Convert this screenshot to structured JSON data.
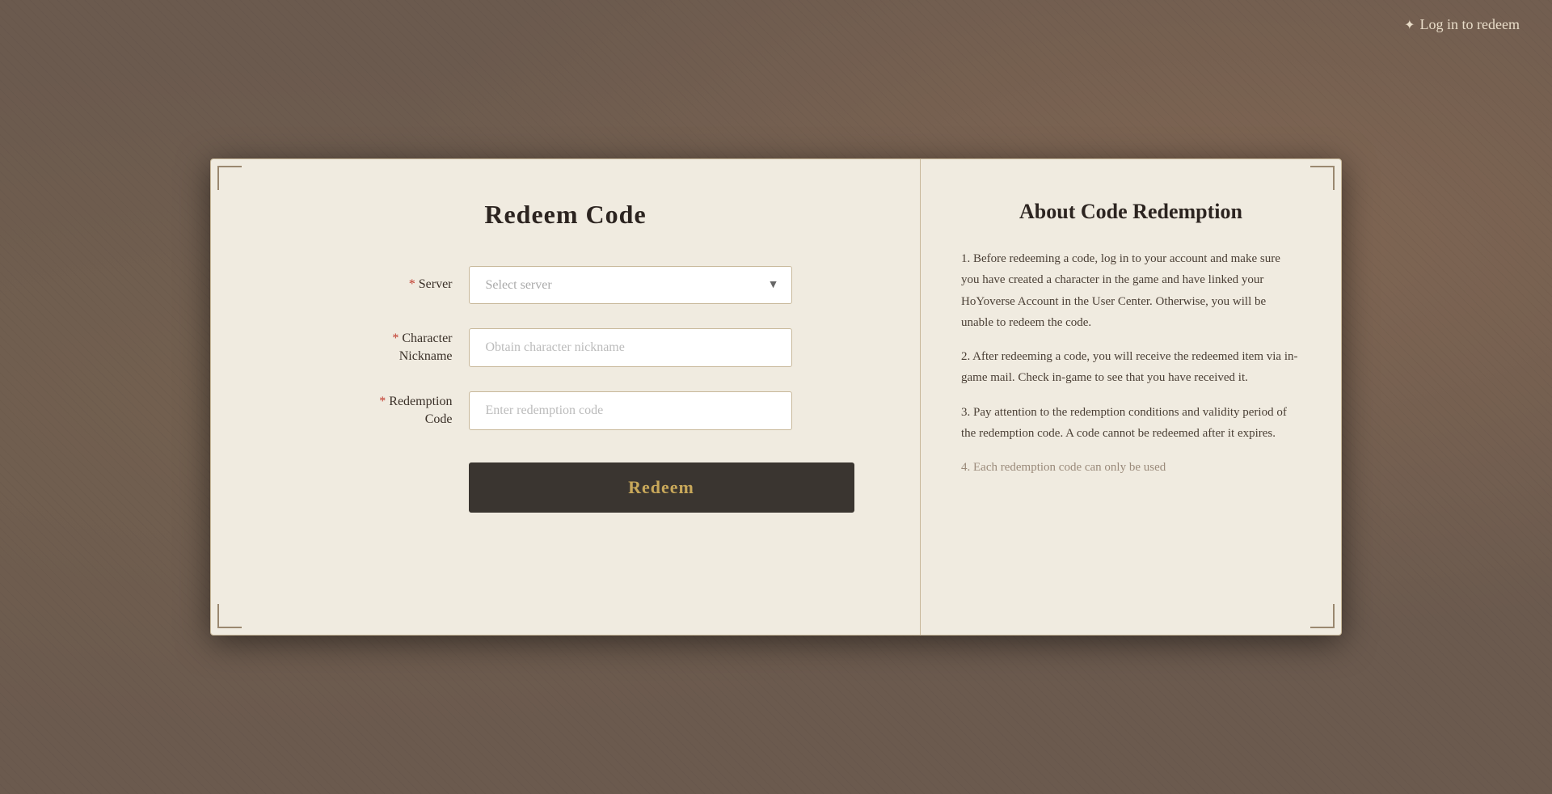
{
  "page": {
    "background_alt": "Game themed background"
  },
  "topbar": {
    "login_label": "Log in to redeem",
    "star_icon": "✦"
  },
  "left_panel": {
    "title": "Redeem Code",
    "form": {
      "server_label": "Server",
      "server_placeholder": "Select server",
      "nickname_label": "Character\nNickname",
      "nickname_label_line1": "Character",
      "nickname_label_line2": "Nickname",
      "nickname_placeholder": "Obtain character nickname",
      "code_label": "Redemption\nCode",
      "code_label_line1": "Redemption",
      "code_label_line2": "Code",
      "code_placeholder": "Enter redemption code",
      "redeem_button": "Redeem",
      "required_symbol": "*"
    }
  },
  "right_panel": {
    "title": "About Code Redemption",
    "items": [
      {
        "id": 1,
        "text": "1. Before redeeming a code, log in to your account and make sure you have created a character in the game and have linked your HoYoverse Account in the User Center. Otherwise, you will be unable to redeem the code."
      },
      {
        "id": 2,
        "text": "2. After redeeming a code, you will receive the redeemed item via in-game mail. Check in-game to see that you have received it."
      },
      {
        "id": 3,
        "text": "3. Pay attention to the redemption conditions and validity period of the redemption code. A code cannot be redeemed after it expires."
      },
      {
        "id": 4,
        "text": "4. Each redemption code can only be used",
        "faded": true
      }
    ]
  }
}
